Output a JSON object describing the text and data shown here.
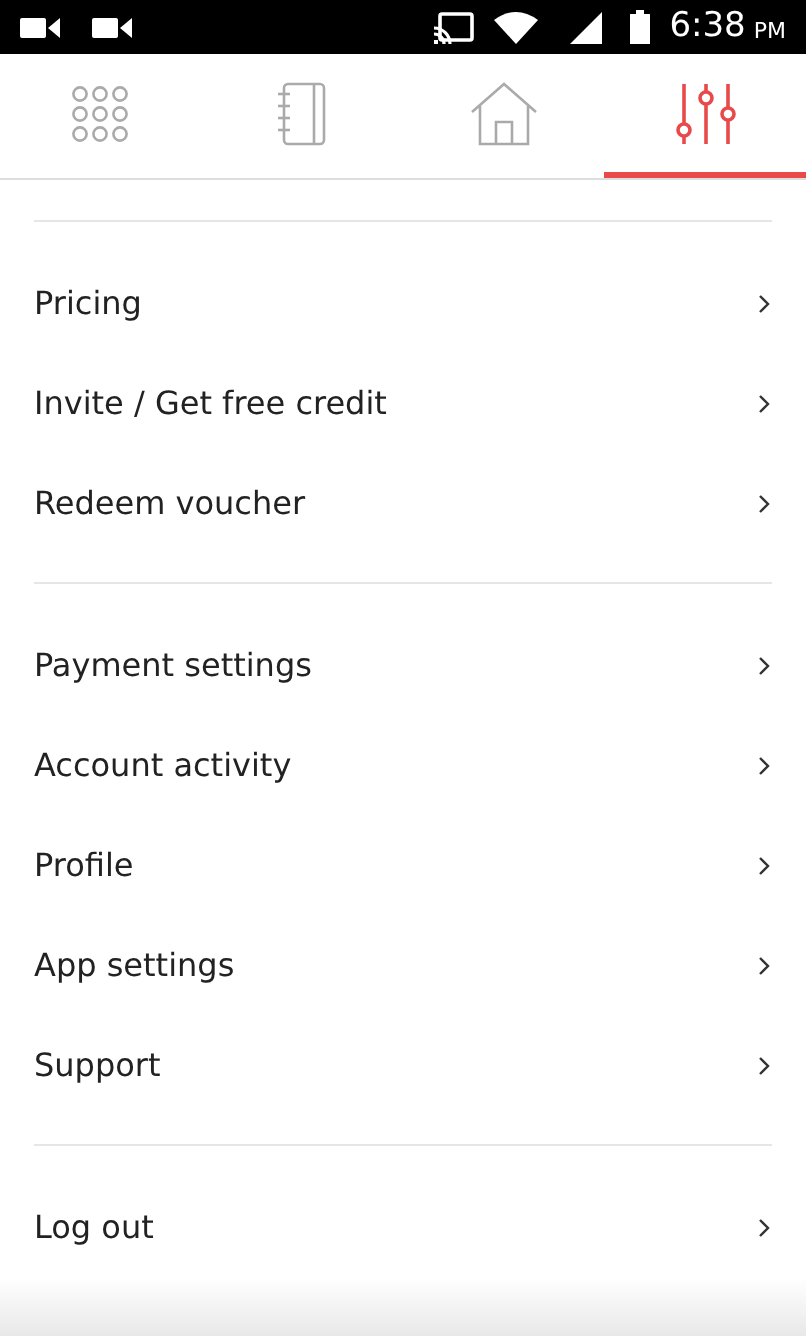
{
  "status_bar": {
    "time": "6:38",
    "ampm": "PM"
  },
  "tabs": [
    {
      "kind": "grid",
      "selected": false
    },
    {
      "kind": "notebook",
      "selected": false
    },
    {
      "kind": "home",
      "selected": false
    },
    {
      "kind": "sliders",
      "selected": true
    }
  ],
  "sections": [
    {
      "items": [
        {
          "label": "Pricing"
        },
        {
          "label": "Invite / Get free credit"
        },
        {
          "label": "Redeem voucher"
        }
      ]
    },
    {
      "items": [
        {
          "label": "Payment settings"
        },
        {
          "label": "Account activity"
        },
        {
          "label": "Profile"
        },
        {
          "label": "App settings"
        },
        {
          "label": "Support"
        }
      ]
    },
    {
      "items": [
        {
          "label": "Log out"
        }
      ]
    }
  ]
}
